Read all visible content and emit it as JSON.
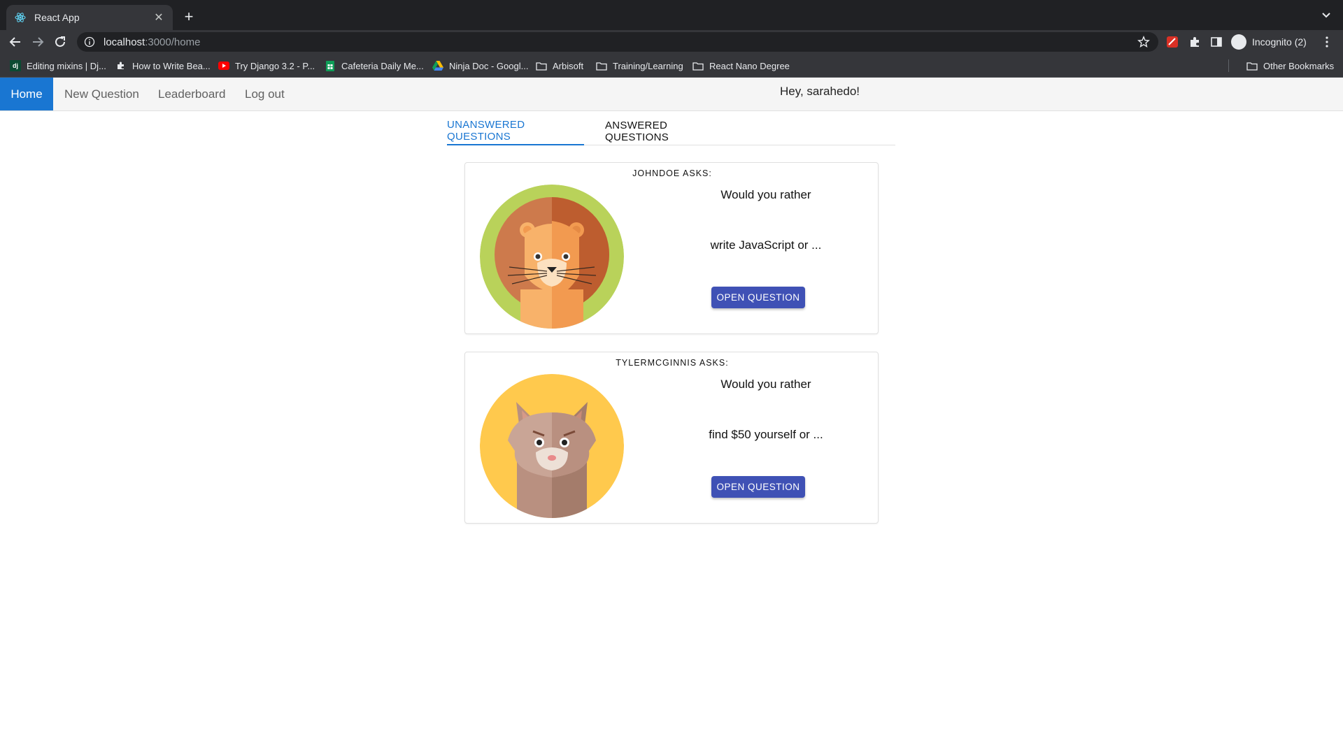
{
  "browser": {
    "tab_title": "React App",
    "url_host": "localhost",
    "url_rest": ":3000/home",
    "profile_label": "Incognito (2)",
    "bookmarks": [
      {
        "label": "Editing mixins | Dj...",
        "icon": "django-icon"
      },
      {
        "label": "How to Write Bea...",
        "icon": "puzzle-icon"
      },
      {
        "label": "Try Django 3.2 - P...",
        "icon": "youtube-icon"
      },
      {
        "label": "Cafeteria Daily Me...",
        "icon": "sheets-icon"
      },
      {
        "label": "Ninja Doc - Googl...",
        "icon": "drive-icon"
      },
      {
        "label": "Arbisoft",
        "icon": "folder-icon"
      },
      {
        "label": "Training/Learning",
        "icon": "folder-icon"
      },
      {
        "label": "React Nano Degree",
        "icon": "folder-icon"
      }
    ],
    "other_bookmarks": "Other Bookmarks"
  },
  "nav": {
    "items": [
      "Home",
      "New Question",
      "Leaderboard",
      "Log out"
    ],
    "active": "Home",
    "greeting": "Hey, sarahedo!",
    "accent": "#1976d2"
  },
  "tabs": {
    "unanswered": "UNANSWERED QUESTIONS",
    "answered": "ANSWERED QUESTIONS",
    "active": "unanswered"
  },
  "questions": [
    {
      "author_line": "JOHNDOE ASKS:",
      "avatar": "lion-avatar",
      "prompt": "Would you rather",
      "option_preview": "write JavaScript or ...",
      "button": "OPEN QUESTION"
    },
    {
      "author_line": "TYLERMCGINNIS ASKS:",
      "avatar": "cat-avatar",
      "prompt": "Would you rather",
      "option_preview": "find $50 yourself or ...",
      "button": "OPEN QUESTION"
    }
  ],
  "colors": {
    "button": "#3f51b5",
    "chrome_dark": "#202124",
    "chrome_toolbar": "#35363a"
  }
}
